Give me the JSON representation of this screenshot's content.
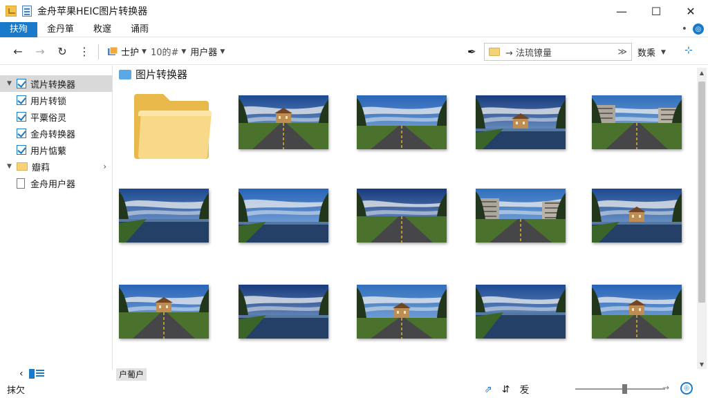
{
  "window": {
    "title": "金舟苹果HEIC图片转换器",
    "minimize_glyph": "—",
    "maximize_glyph": "☐",
    "close_glyph": "✕"
  },
  "menu": {
    "items": [
      {
        "label": "扶殉",
        "active": true
      },
      {
        "label": "金丹箪",
        "active": false
      },
      {
        "label": "敉邃",
        "active": false
      },
      {
        "label": "诵雨",
        "active": false
      }
    ],
    "right_glyph": "•",
    "help_glyph": "◎"
  },
  "toolbar": {
    "back_glyph": "←",
    "forward_glyph": "→",
    "refresh_glyph": "↻",
    "more_glyph": "⋮",
    "drop1_label": "士护",
    "drop2_label": "10的#",
    "drop3_label": "用户器",
    "pen_glyph": "✒",
    "address_text": "→  法琉镣量",
    "address_end_glyph": "≫",
    "view_label": "数乘",
    "right_glyph": "⊹"
  },
  "sidebar": {
    "items": [
      {
        "label": "谎片转换器",
        "type": "check",
        "selected": true,
        "expander": "▼"
      },
      {
        "label": "用片转锁",
        "type": "check",
        "selected": false
      },
      {
        "label": "平粟俗灵",
        "type": "check",
        "selected": false
      },
      {
        "label": "金舟转换器",
        "type": "check",
        "selected": false
      },
      {
        "label": "用片惦蘩",
        "type": "check",
        "selected": false
      },
      {
        "label": "瓣萪",
        "type": "folder",
        "selected": false,
        "expander": "▼",
        "chevron": "›"
      },
      {
        "label": "金舟用户器",
        "type": "doc",
        "selected": false
      }
    ],
    "bottom_arrow": "‹"
  },
  "content": {
    "folder_title": "图片转换器",
    "tag_label": "户葡户"
  },
  "tiles": [
    {
      "name": "photo-castle-avenue",
      "scene": "castle"
    },
    {
      "name": "photo-road-sunset",
      "scene": "road"
    },
    {
      "name": "photo-canal-manor",
      "scene": "canal"
    },
    {
      "name": "photo-city-road",
      "scene": "cityroad"
    },
    {
      "name": "photo-lake-clouds",
      "scene": "lake"
    },
    {
      "name": "photo-river-trees",
      "scene": "river"
    },
    {
      "name": "photo-highway-forest",
      "scene": "highway"
    },
    {
      "name": "photo-apartment-blocks",
      "scene": "buildings"
    },
    {
      "name": "photo-manor-reflection",
      "scene": "manor"
    },
    {
      "name": "photo-castle-road",
      "scene": "castleroad"
    },
    {
      "name": "photo-coast-path",
      "scene": "coast"
    },
    {
      "name": "photo-country-road",
      "scene": "country"
    },
    {
      "name": "photo-canal-clouds",
      "scene": "canal2"
    },
    {
      "name": "photo-evening-road",
      "scene": "evening"
    }
  ],
  "statusbar": {
    "text": "抹欠",
    "icon1": "⇗",
    "icon2": "⇵",
    "icon3": "叐",
    "zoom_arrow": "→",
    "right_glyph": "◎",
    "zoom_level": 0.55
  },
  "colors": {
    "accent": "#1979ca",
    "folder": "#f5d27a"
  }
}
